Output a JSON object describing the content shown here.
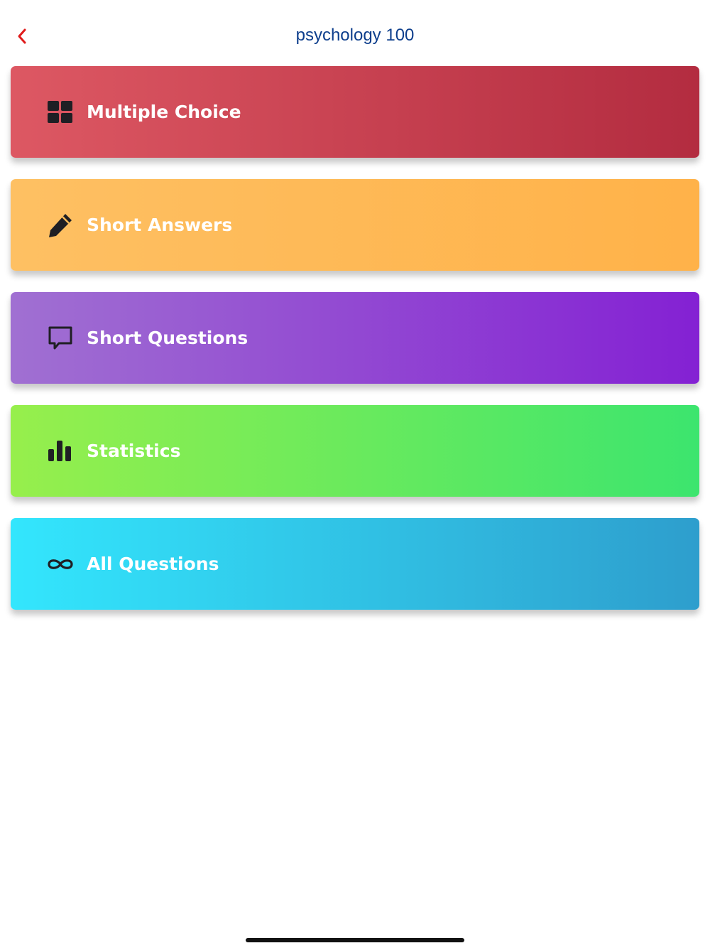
{
  "header": {
    "title": "psychology 100",
    "title_color": "#0d3e8c",
    "back_icon": "chevron-left-icon",
    "back_color": "#e01b1b"
  },
  "menu": {
    "items": [
      {
        "label": "Multiple Choice",
        "icon": "grid-icon",
        "gradient": [
          "#dd5863",
          "#b32c40"
        ]
      },
      {
        "label": "Short Answers",
        "icon": "pencil-icon",
        "gradient": [
          "#fec063",
          "#ffb249"
        ]
      },
      {
        "label": "Short Questions",
        "icon": "chat-bubble-icon",
        "gradient": [
          "#a070d2",
          "#8421d3"
        ]
      },
      {
        "label": "Statistics",
        "icon": "bar-chart-icon",
        "gradient": [
          "#97ef4c",
          "#3ce56e"
        ]
      },
      {
        "label": "All Questions",
        "icon": "infinity-icon",
        "gradient": [
          "#33e6fd",
          "#2e9ecd"
        ]
      }
    ]
  }
}
